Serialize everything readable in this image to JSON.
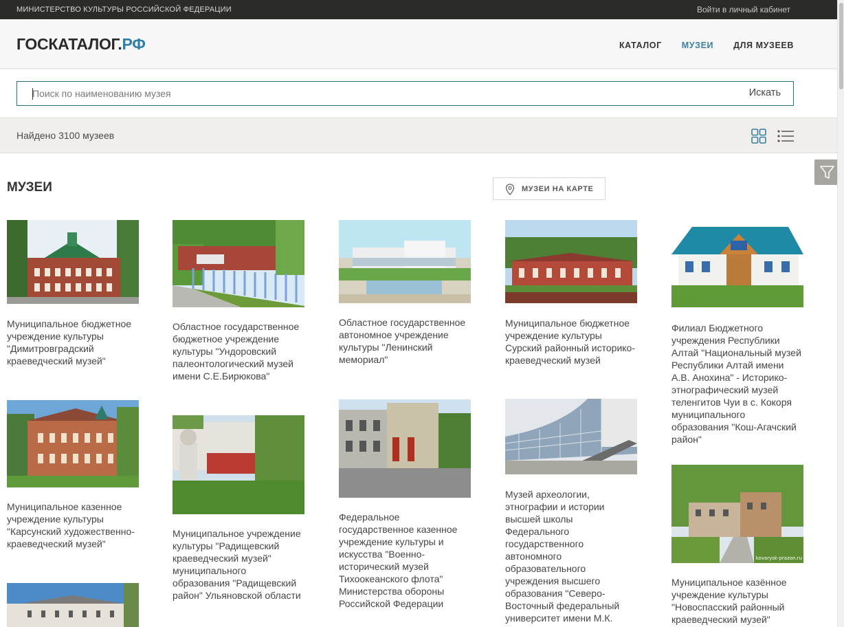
{
  "topbar": {
    "ministry": "МИНИСТЕРСТВО КУЛЬТУРЫ РОССИЙСКОЙ ФЕДЕРАЦИИ",
    "login": "Войти в личный кабинет"
  },
  "header": {
    "logo_main": "ГОСКАТАЛОГ.",
    "logo_rf": "РФ",
    "nav": [
      "КАТАЛОГ",
      "МУЗЕИ",
      "ДЛЯ МУЗЕЕВ"
    ],
    "active_nav": "МУЗЕИ"
  },
  "search": {
    "placeholder": "Поиск по наименованию музея",
    "button": "Искать"
  },
  "results": {
    "count_text": "Найдено 3100 музеев"
  },
  "section": {
    "title": "МУЗЕИ",
    "map_button": "МУЗЕИ НА КАРТЕ"
  },
  "museums": [
    {
      "title": "Муниципальное бюджетное учреждение культуры \"Димитровградский краеведческий музей\""
    },
    {
      "title": "Областное государственное бюджетное учреждение культуры \"Ундоровский палеонтологический музей имени С.Е.Бирюкова\""
    },
    {
      "title": "Областное государственное автономное учреждение культуры \"Ленинский мемориал\""
    },
    {
      "title": "Муниципальное бюджетное учреждение культуры Сурский районный историко-краеведческий музей"
    },
    {
      "title": "Филиал Бюджетного учреждения Республики Алтай \"Национальный музей Республики Алтай имени А.В. Анохина\" - Историко-этнографический музей теленгитов Чуи в с. Кокоря муниципального образования \"Кош-Агачский район\""
    },
    {
      "title": "Муниципальное казенное учреждение культуры \"Карсунский художественно-краеведческий музей\""
    },
    {
      "title": "Муниципальное учреждение культуры \"Радищевский краеведческий музей\" муниципального образования \"Радищевский район\" Ульяновской области"
    },
    {
      "title": "Федеральное государственное казенное учреждение культуры и искусства \"Военно-исторический музей Тихоокеанского флота\" Министерства обороны Российской Федерации"
    },
    {
      "title": "Музей археологии, этнографии и истории высшей школы Федерального государственного автономного образовательного учреждения высшего образования \"Северо-Восточный федеральный университет имени М.К. Аммосова\""
    },
    {
      "title": "Муниципальное казённое учреждение культуры \"Новоспасский районный краеведческий музей\""
    },
    {
      "title": ""
    }
  ],
  "photo_watermark": "kovarysk-prazon.ru",
  "colors": {
    "accent": "#3a7fa3",
    "topbar": "#2b2b28",
    "search_border": "#2d6e87",
    "found_bar": "#f0efeb"
  }
}
